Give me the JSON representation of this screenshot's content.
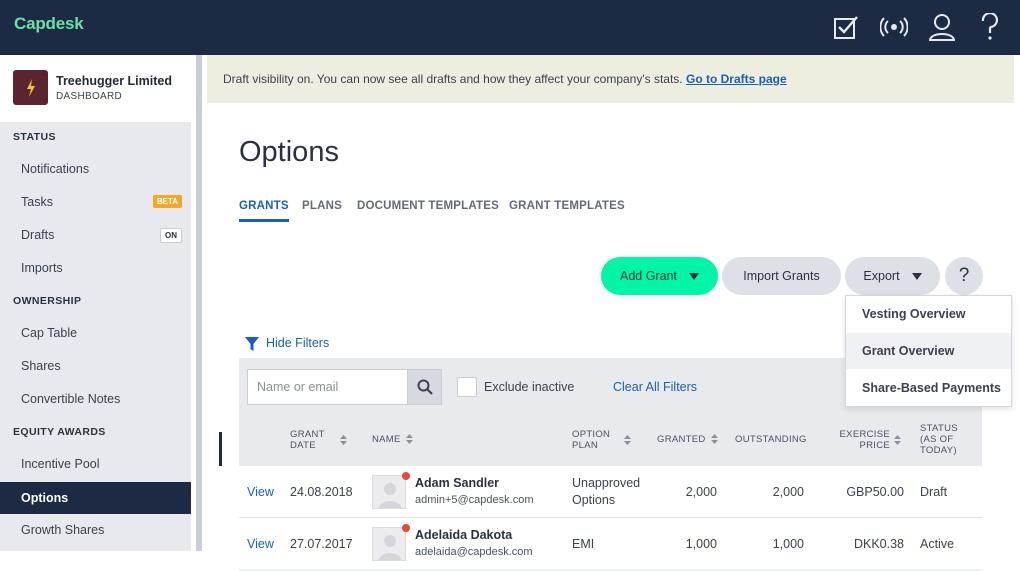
{
  "app": {
    "logo": "Capdesk"
  },
  "company": {
    "name": "Treehugger Limited",
    "subtitle": "DASHBOARD"
  },
  "sidebar": {
    "sections": [
      {
        "label": "STATUS"
      },
      {
        "label": "OWNERSHIP"
      },
      {
        "label": "EQUITY AWARDS"
      }
    ],
    "items": [
      {
        "label": "Notifications"
      },
      {
        "label": "Tasks",
        "badge": "BETA"
      },
      {
        "label": "Drafts",
        "badge": "ON"
      },
      {
        "label": "Imports"
      },
      {
        "label": "Cap Table"
      },
      {
        "label": "Shares"
      },
      {
        "label": "Convertible Notes"
      },
      {
        "label": "Incentive Pool"
      },
      {
        "label": "Options"
      },
      {
        "label": "Growth Shares"
      }
    ]
  },
  "banner": {
    "text": "Draft visibility on. You can now see all drafts and how they affect your company's stats. ",
    "link": "Go to Drafts page"
  },
  "page": {
    "title": "Options"
  },
  "tabs": [
    {
      "label": "GRANTS"
    },
    {
      "label": "PLANS"
    },
    {
      "label": "DOCUMENT TEMPLATES"
    },
    {
      "label": "GRANT TEMPLATES"
    }
  ],
  "actions": {
    "add_grant": "Add Grant",
    "import_grants": "Import Grants",
    "export": "Export",
    "help": "?"
  },
  "export_menu": [
    {
      "label": "Vesting Overview"
    },
    {
      "label": "Grant Overview"
    },
    {
      "label": "Share-Based Payments"
    }
  ],
  "filters": {
    "toggle": "Hide Filters",
    "search_placeholder": "Name or email",
    "exclude_inactive": "Exclude inactive",
    "clear": "Clear All Filters"
  },
  "table": {
    "headers": {
      "grant_date_1": "GRANT",
      "grant_date_2": "DATE",
      "name": "NAME",
      "option_plan_1": "OPTION",
      "option_plan_2": "PLAN",
      "granted": "GRANTED",
      "outstanding": "OUTSTANDING",
      "exercise_1": "EXERCISE",
      "exercise_2": "PRICE",
      "status_1": "STATUS",
      "status_2": "(AS OF",
      "status_3": "TODAY)"
    },
    "rows": [
      {
        "view": "View",
        "date": "24.08.2018",
        "name": "Adam Sandler",
        "email": "admin+5@capdesk.com",
        "plan_1": "Unapproved",
        "plan_2": "Options",
        "granted": "2,000",
        "outstanding": "2,000",
        "price": "GBP50.00",
        "status": "Draft"
      },
      {
        "view": "View",
        "date": "27.07.2017",
        "name": "Adelaida Dakota",
        "email": "adelaida@capdesk.com",
        "plan_1": "EMI",
        "plan_2": "",
        "granted": "1,000",
        "outstanding": "1,000",
        "price": "DKK0.38",
        "status": "Active"
      }
    ]
  },
  "colors": {
    "navy": "#1c2a44",
    "accent": "#00f5a6",
    "link": "#1a5fb4",
    "badge_beta": "#f5a623",
    "alert_dot": "#e8463c"
  }
}
